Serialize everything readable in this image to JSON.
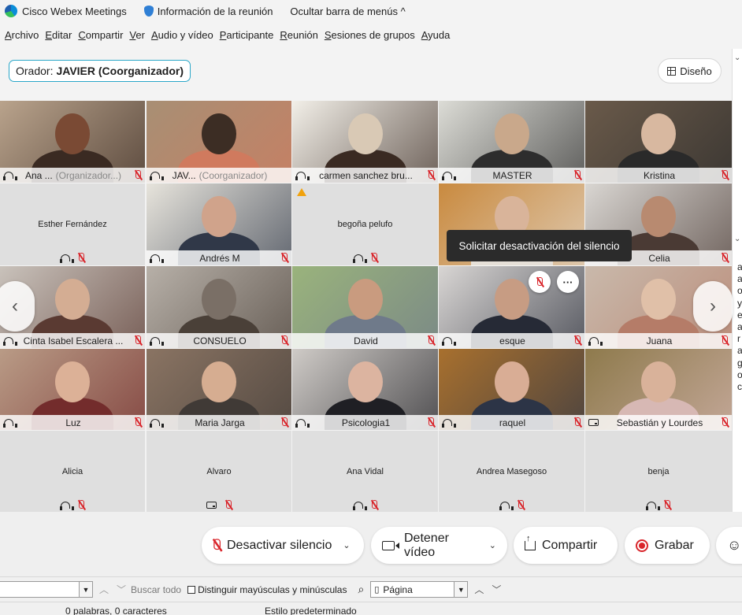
{
  "titlebar": {
    "app_name": "Cisco Webex Meetings",
    "info": "Información de la reunión",
    "hide_menu": "Ocultar barra de menús ^"
  },
  "menu": [
    "Archivo",
    "Editar",
    "Compartir",
    "Ver",
    "Audio y vídeo",
    "Participante",
    "Reunión",
    "Sesiones de grupos",
    "Ayuda"
  ],
  "speaker": {
    "label": "Orador:",
    "name": "JAVIER (Coorganizador)"
  },
  "layout_button": "Diseño",
  "tooltip": "Solicitar desactivación del silencio",
  "tile_more": "···",
  "participants": [
    {
      "name": "Ana ...",
      "role": "(Organizador...)",
      "kind": "video",
      "icon": "audio",
      "muted": true
    },
    {
      "name": "JAV...",
      "role": "(Coorganizador)",
      "kind": "video",
      "icon": "audio",
      "muted": false,
      "active": true
    },
    {
      "name": "carmen sanchez bru...",
      "role": "",
      "kind": "video",
      "icon": "audio",
      "muted": true
    },
    {
      "name": "MASTER",
      "role": "",
      "kind": "video",
      "icon": "audio",
      "muted": true
    },
    {
      "name": "Kristina",
      "role": "",
      "kind": "video",
      "icon": "",
      "muted": true
    },
    {
      "name": "Esther Fernández",
      "role": "",
      "kind": "empty",
      "icon": "audio",
      "muted": true
    },
    {
      "name": "Andrés M",
      "role": "",
      "kind": "video",
      "icon": "audio",
      "muted": true
    },
    {
      "name": "begoña pelufo",
      "role": "",
      "kind": "empty",
      "icon": "audio",
      "muted": true,
      "warning": true
    },
    {
      "name": "",
      "role": "",
      "kind": "video",
      "icon": "",
      "muted": false
    },
    {
      "name": "Celia",
      "role": "",
      "kind": "video",
      "icon": "",
      "muted": true
    },
    {
      "name": "Cinta Isabel Escalera ...",
      "role": "",
      "kind": "video",
      "icon": "audio",
      "muted": true
    },
    {
      "name": "CONSUELO",
      "role": "",
      "kind": "video",
      "icon": "audio",
      "muted": true
    },
    {
      "name": "David",
      "role": "",
      "kind": "video",
      "icon": "",
      "muted": true
    },
    {
      "name": "esque",
      "role": "",
      "kind": "video",
      "icon": "audio",
      "muted": true
    },
    {
      "name": "Juana",
      "role": "",
      "kind": "video",
      "icon": "audio",
      "muted": true
    },
    {
      "name": "Luz",
      "role": "",
      "kind": "video",
      "icon": "audio",
      "muted": true
    },
    {
      "name": "Maria Jarga",
      "role": "",
      "kind": "video",
      "icon": "audio",
      "muted": true
    },
    {
      "name": "Psicologia1",
      "role": "",
      "kind": "video",
      "icon": "audio",
      "muted": true
    },
    {
      "name": "raquel",
      "role": "",
      "kind": "video",
      "icon": "audio",
      "muted": true
    },
    {
      "name": "Sebastián y Lourdes",
      "role": "",
      "kind": "video",
      "icon": "screen",
      "muted": true
    },
    {
      "name": "Alicia",
      "role": "",
      "kind": "empty",
      "icon": "audio",
      "muted": true
    },
    {
      "name": "Alvaro",
      "role": "",
      "kind": "empty",
      "icon": "screen",
      "muted": true
    },
    {
      "name": "Ana Vidal",
      "role": "",
      "kind": "empty",
      "icon": "audio",
      "muted": true
    },
    {
      "name": "Andrea Masegoso",
      "role": "",
      "kind": "empty",
      "icon": "audio",
      "muted": true
    },
    {
      "name": "benja",
      "role": "",
      "kind": "empty",
      "icon": "audio",
      "muted": true
    }
  ],
  "controls": {
    "mute": "Desactivar silencio",
    "video": "Detener vídeo",
    "share": "Compartir",
    "record": "Grabar"
  },
  "right_panel_fragments": [
    "a",
    "a",
    "o",
    "y",
    "e",
    "a",
    "r",
    "a",
    "g",
    "o",
    "c"
  ],
  "findbar": {
    "search_label": "Buscar todo",
    "match_case": "Distinguir mayúsculas y minúsculas",
    "page_select": "Página"
  },
  "statusbar": {
    "words": "0 palabras, 0 caracteres",
    "style": "Estilo predeterminado"
  },
  "colors": {
    "accent": "#2fb3dc",
    "muted_red": "#d9252b",
    "warning": "#f1a20d"
  }
}
